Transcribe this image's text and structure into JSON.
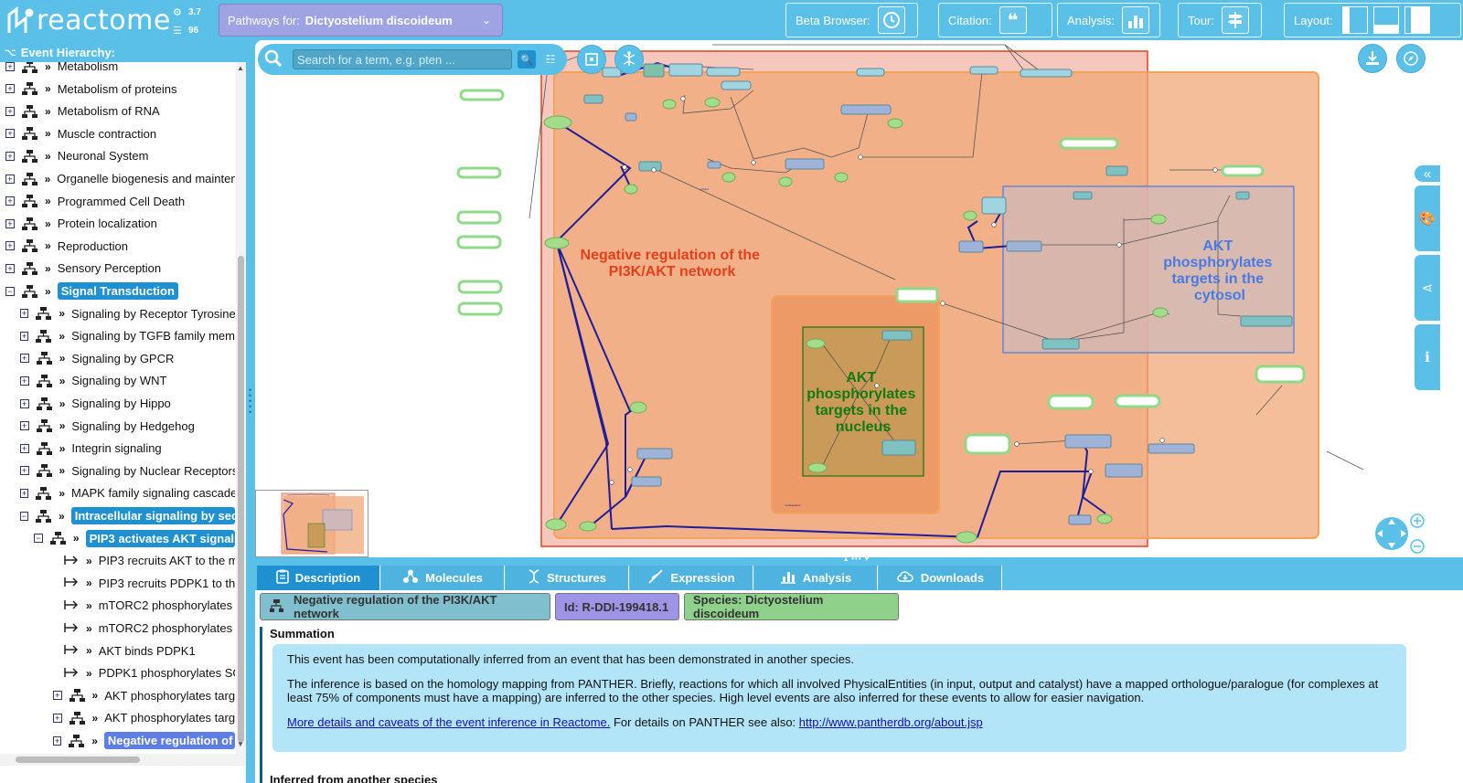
{
  "header": {
    "logo_text": "reactome",
    "version_release": "3.7",
    "version_db": "96",
    "species_label": "Pathways for:",
    "species_value": "Dictyostelium discoideum",
    "beta_label": "Beta Browser:",
    "citation_label": "Citation:",
    "analysis_label": "Analysis:",
    "tour_label": "Tour:",
    "layout_label": "Layout:"
  },
  "hierarchy": {
    "title": "Event Hierarchy:",
    "items": [
      {
        "label": "Metabolism",
        "level": 0,
        "kind": "pathway",
        "state": "plus"
      },
      {
        "label": "Metabolism of proteins",
        "level": 0,
        "kind": "pathway",
        "state": "plus"
      },
      {
        "label": "Metabolism of RNA",
        "level": 0,
        "kind": "pathway",
        "state": "plus"
      },
      {
        "label": "Muscle contraction",
        "level": 0,
        "kind": "pathway",
        "state": "plus"
      },
      {
        "label": "Neuronal System",
        "level": 0,
        "kind": "pathway",
        "state": "plus"
      },
      {
        "label": "Organelle biogenesis and maintena",
        "level": 0,
        "kind": "pathway",
        "state": "plus"
      },
      {
        "label": "Programmed Cell Death",
        "level": 0,
        "kind": "pathway",
        "state": "plus"
      },
      {
        "label": "Protein localization",
        "level": 0,
        "kind": "pathway",
        "state": "plus"
      },
      {
        "label": "Reproduction",
        "level": 0,
        "kind": "pathway",
        "state": "plus"
      },
      {
        "label": "Sensory Perception",
        "level": 0,
        "kind": "pathway",
        "state": "plus"
      },
      {
        "label": "Signal Transduction",
        "level": 0,
        "kind": "pathway",
        "state": "minus",
        "hl": "primary"
      },
      {
        "label": "Signaling by Receptor Tyrosine I",
        "level": 1,
        "kind": "pathway",
        "state": "plus"
      },
      {
        "label": "Signaling by TGFB family memb",
        "level": 1,
        "kind": "pathway",
        "state": "plus"
      },
      {
        "label": "Signaling by GPCR",
        "level": 1,
        "kind": "pathway",
        "state": "plus"
      },
      {
        "label": "Signaling by WNT",
        "level": 1,
        "kind": "pathway",
        "state": "plus"
      },
      {
        "label": "Signaling by Hippo",
        "level": 1,
        "kind": "pathway",
        "state": "plus"
      },
      {
        "label": "Signaling by Hedgehog",
        "level": 1,
        "kind": "pathway",
        "state": "plus"
      },
      {
        "label": "Integrin signaling",
        "level": 1,
        "kind": "pathway",
        "state": "plus"
      },
      {
        "label": "Signaling by Nuclear Receptors",
        "level": 1,
        "kind": "pathway",
        "state": "plus"
      },
      {
        "label": "MAPK family signaling cascades",
        "level": 1,
        "kind": "pathway",
        "state": "plus"
      },
      {
        "label": "Intracellular signaling by seco",
        "level": 1,
        "kind": "pathway",
        "state": "minus",
        "hl": "primary"
      },
      {
        "label": "PIP3 activates AKT signalii",
        "level": 2,
        "kind": "pathway",
        "state": "minus",
        "hl": "primary"
      },
      {
        "label": "PIP3 recruits AKT to the m",
        "level": 3,
        "kind": "reaction"
      },
      {
        "label": "PIP3 recruits PDPK1 to the",
        "level": 3,
        "kind": "reaction"
      },
      {
        "label": "mTORC2 phosphorylates A",
        "level": 3,
        "kind": "reaction"
      },
      {
        "label": "mTORC2 phosphorylates S",
        "level": 3,
        "kind": "reaction"
      },
      {
        "label": "AKT binds PDPK1",
        "level": 3,
        "kind": "reaction"
      },
      {
        "label": "PDPK1 phosphorylates SG",
        "level": 3,
        "kind": "reaction"
      },
      {
        "label": "AKT phosphorylates target",
        "level": 3,
        "kind": "pathway",
        "state": "plus"
      },
      {
        "label": "AKT phosphorylates target",
        "level": 3,
        "kind": "pathway",
        "state": "plus"
      },
      {
        "label": "Negative regulation of th",
        "level": 3,
        "kind": "pathway",
        "state": "plus",
        "hl": "secondary"
      }
    ]
  },
  "diagram": {
    "search_placeholder": "Search for a term, e.g. pten ...",
    "compartments": [
      {
        "label_lines": [
          "Negative regulation of the",
          "PI3K/AKT network"
        ],
        "color": "#e2401f"
      },
      {
        "label_lines": [
          "AKT",
          "phosphorylates",
          "targets in the",
          "cytosol"
        ],
        "color": "#4a7ae0"
      },
      {
        "label_lines": [
          "AKT",
          "phosphorylates",
          "targets in the",
          "nucleus"
        ],
        "color": "#137a13"
      }
    ],
    "tiny_labels": [
      "cytosol",
      "nucleoplasm"
    ]
  },
  "details": {
    "tabs": [
      {
        "label": "Description",
        "icon": "clipboard-icon"
      },
      {
        "label": "Molecules",
        "icon": "molecules-icon"
      },
      {
        "label": "Structures",
        "icon": "dna-icon"
      },
      {
        "label": "Expression",
        "icon": "expression-icon"
      },
      {
        "label": "Analysis",
        "icon": "bar-chart-icon"
      },
      {
        "label": "Downloads",
        "icon": "cloud-download-icon"
      }
    ],
    "badge_name": "Negative regulation of the PI3K/AKT network",
    "badge_id": "Id: R-DDI-199418.1",
    "badge_species": "Species: Dictyostelium discoideum",
    "summation_title": "Summation",
    "summation_p1": "This event has been computationally inferred from an event that has been demonstrated in another species.",
    "summation_p2": "The inference is based on the homology mapping from PANTHER. Briefly, reactions for which all involved PhysicalEntities (in input, output and catalyst) have a mapped orthologue/paralogue (for complexes at least 75% of components must have a mapping) are inferred to the other species. High level events are also inferred for these events to allow for easier navigation.",
    "summation_link1": "More details and caveats of the event inference in Reactome.",
    "summation_mid": " For details on PANTHER see also: ",
    "summation_link2": "http://www.pantherdb.org/about.jsp",
    "inferred_title": "Inferred from another species"
  },
  "colors": {
    "brand": "#5bc0e8",
    "active_tab": "#1f90d0",
    "badge_name_bg": "#7fbfce",
    "badge_id_bg": "#9d94e6",
    "badge_species_bg": "#8fd18b",
    "summation_bg": "#b3e5f9"
  }
}
